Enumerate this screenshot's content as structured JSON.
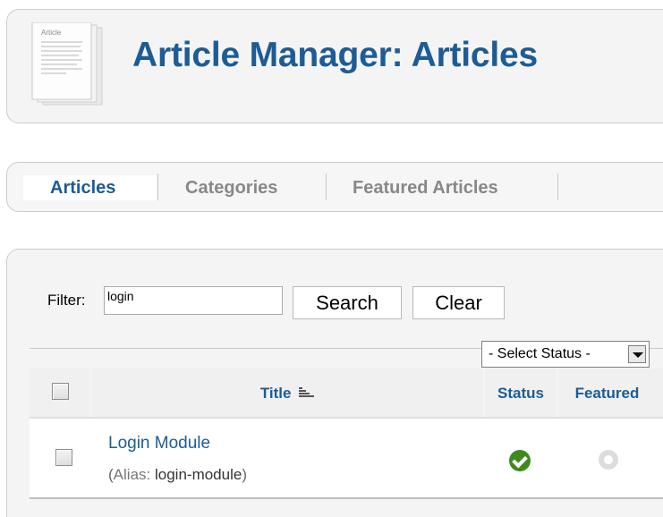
{
  "header": {
    "title": "Article Manager: Articles",
    "icon": "article-document-icon"
  },
  "submenu": {
    "tabs": [
      {
        "label": "Articles",
        "active": true
      },
      {
        "label": "Categories",
        "active": false
      },
      {
        "label": "Featured Articles",
        "active": false
      }
    ]
  },
  "filter": {
    "label": "Filter:",
    "value": "login",
    "search_label": "Search",
    "clear_label": "Clear",
    "status_select": "- Select Status -"
  },
  "table": {
    "columns": {
      "title": "Title",
      "status": "Status",
      "featured": "Featured"
    },
    "sort_icon": "sort-ascending-icon",
    "rows": [
      {
        "title": "Login Module",
        "alias_open": "(",
        "alias_label": "Alias:",
        "alias_value": "login-module",
        "alias_close": ")",
        "status_icon": "published-check-icon",
        "featured_icon": "not-featured-icon"
      }
    ]
  },
  "colors": {
    "accent": "#1d5c94",
    "published": "#3e8a1f",
    "muted_tab": "#888888"
  }
}
